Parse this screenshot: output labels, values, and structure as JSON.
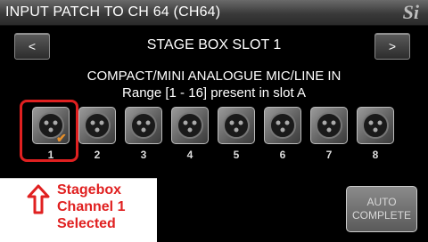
{
  "window": {
    "title": "INPUT PATCH TO CH 64 (CH64)",
    "logo": "Si"
  },
  "nav": {
    "prev_label": "<",
    "next_label": ">",
    "slot_title": "STAGE BOX SLOT 1"
  },
  "module": {
    "name": "COMPACT/MINI ANALOGUE MIC/LINE IN",
    "range": "Range [1 - 16] present in slot A"
  },
  "sockets": {
    "labels": [
      "1",
      "2",
      "3",
      "4",
      "5",
      "6",
      "7",
      "8"
    ],
    "selected_index": 0,
    "check_glyph": "✔"
  },
  "annotation": {
    "lines": [
      "Stagebox",
      "Channel 1",
      "Selected"
    ]
  },
  "auto_complete": {
    "line1": "AUTO",
    "line2": "COMPLETE"
  },
  "colors": {
    "annotation": "#e02020",
    "check": "#e8902a"
  }
}
